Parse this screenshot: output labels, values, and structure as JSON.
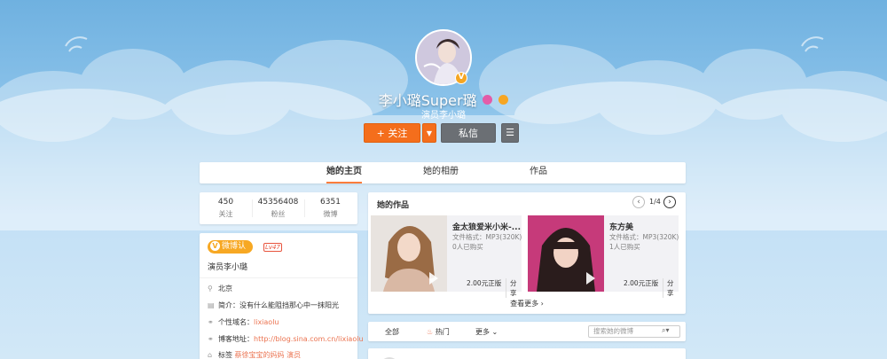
{
  "profile": {
    "name": "李小璐Super璐",
    "description": "演员李小璐",
    "follow_label": "+ 关注",
    "dropdown_icon": "caret-down-icon",
    "message_label": "私信",
    "menu_icon": "hamburger-icon"
  },
  "tabs": [
    {
      "label": "她的主页",
      "active": true
    },
    {
      "label": "她的相册",
      "active": false
    },
    {
      "label": "作品",
      "active": false
    }
  ],
  "stats": [
    {
      "value": "450",
      "label": "关注"
    },
    {
      "value": "45356408",
      "label": "粉丝"
    },
    {
      "value": "6351",
      "label": "微博"
    }
  ],
  "info": {
    "verify_badge": "微博认证",
    "level": "Lv47",
    "verify_text": "演员李小璐",
    "location": "北京",
    "intro_label": "简介：",
    "intro_value": "没有什么能阻挡那心中一抹阳光",
    "domain_label": "个性域名：",
    "domain_value": "lixiaolu",
    "blog_label": "博客地址：",
    "blog_value": "http://blog.sina.com.cn/lixiaolu",
    "tags_label": "标签",
    "tags_value": "蔡徐宝宝的妈妈 演员"
  },
  "works": {
    "title": "她的作品",
    "page": "1/4",
    "more_label": "查看更多",
    "items": [
      {
        "title": "金太狼爱米小米-...",
        "format": "文件格式：MP3(320K)",
        "buyers": "0人已购买",
        "price": "2.00元正版",
        "share": "分享"
      },
      {
        "title": "东方美",
        "format": "文件格式：MP3(320K)",
        "buyers": "1人已购买",
        "price": "2.00元正版",
        "share": "分享"
      }
    ]
  },
  "filter": {
    "all_label": "全部",
    "hot_label": "热门",
    "more_label": "更多",
    "search_placeholder": "搜索她的微博"
  },
  "colors": {
    "accent": "#f46e1c",
    "link": "#eb7350",
    "badge": "#f7a823"
  }
}
